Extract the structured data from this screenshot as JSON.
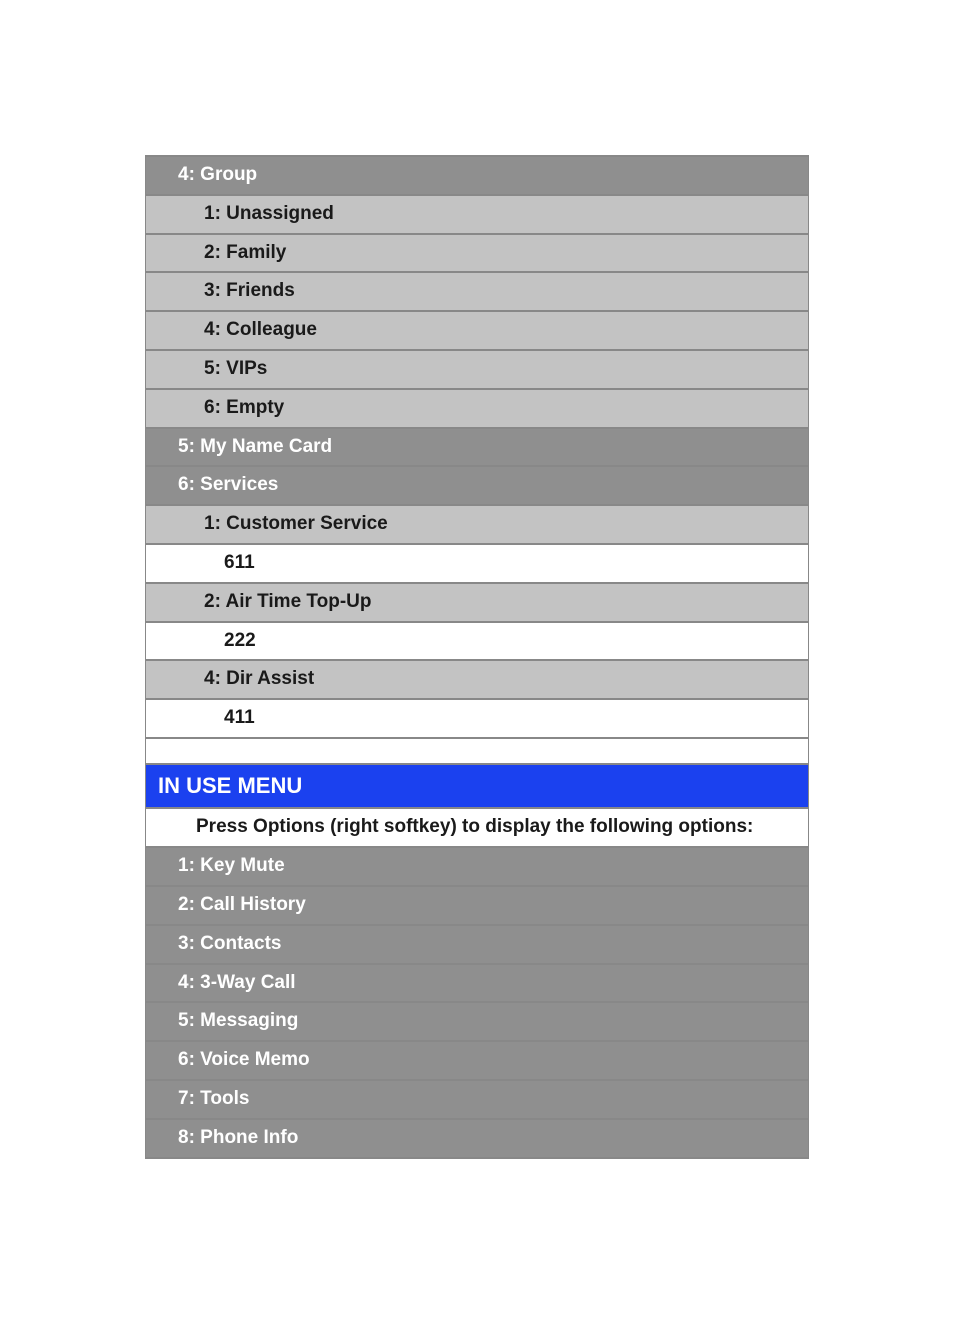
{
  "section1": {
    "group_header": "4: Group",
    "group_items": {
      "unassigned": "1: Unassigned",
      "family": "2: Family",
      "friends": "3: Friends",
      "colleague": "4: Colleague",
      "vips": "5: VIPs",
      "empty": "6: Empty"
    },
    "my_name_card": "5: My Name Card",
    "services": "6: Services",
    "customer_service": "1: Customer Service",
    "customer_service_num": "611",
    "air_time_topup": "2: Air Time Top-Up",
    "air_time_topup_num": "222",
    "dir_assist": "4: Dir Assist",
    "dir_assist_num": "411"
  },
  "section2": {
    "header": "IN USE MENU",
    "instruction": "Press Options (right softkey) to display the following options:",
    "items": {
      "key_mute": "1: Key Mute",
      "call_history": "2: Call History",
      "contacts": "3: Contacts",
      "three_way_call": "4: 3-Way Call",
      "messaging": "5: Messaging",
      "voice_memo": "6: Voice Memo",
      "tools": "7: Tools",
      "phone_info": "8: Phone Info"
    }
  }
}
